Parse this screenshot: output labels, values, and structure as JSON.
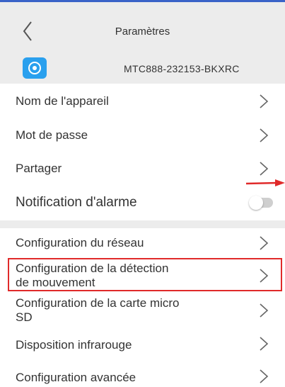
{
  "header": {
    "title": "Paramètres",
    "back_icon": "chevron-left-icon"
  },
  "device": {
    "name": "MTC888-232153-BKXRC",
    "icon": "camera-icon",
    "icon_color": "#2aa0ee"
  },
  "settings": {
    "device_name": "Nom de l'appareil",
    "password": "Mot de passe",
    "share": "Partager",
    "alarm_notification": "Notification d'alarme",
    "alarm_notification_enabled": false,
    "network": "Configuration du réseau",
    "motion_line1": "Configuration de la détection",
    "motion_line2": "de mouvement",
    "sd_line1": "Configuration de la carte micro",
    "sd_line2": "SD",
    "infrared": "Disposition infrarouge",
    "advanced": "Configuration avancée"
  },
  "annotations": {
    "arrow_color": "#e02a2a",
    "highlight_color": "#e02a2a"
  }
}
